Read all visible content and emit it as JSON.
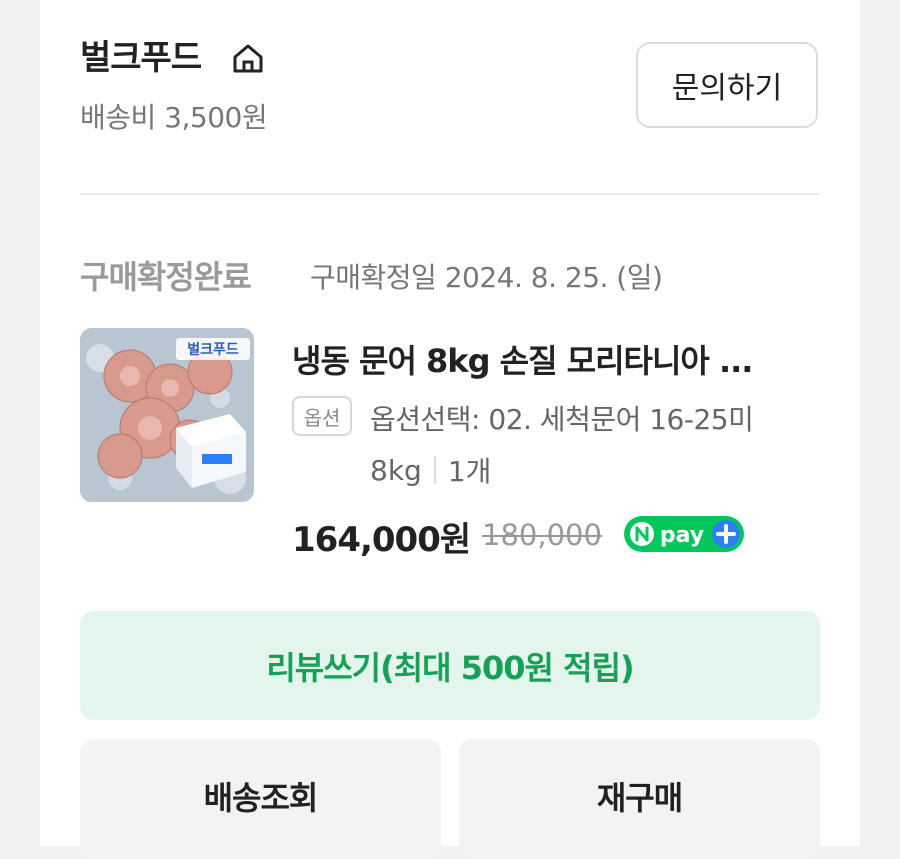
{
  "store": {
    "name": "벌크푸드",
    "shipping_fee": "배송비 3,500원",
    "inquiry_label": "문의하기"
  },
  "order": {
    "status": "구매확정완료",
    "confirm_date": "구매확정일 2024. 8. 25. (일)"
  },
  "product": {
    "title": "냉동 문어 8kg 손질 모리타니아 ...",
    "thumb_brand": "벌크푸드",
    "option_badge": "옵션",
    "option_text": "옵션선택: 02. 세척문어 16-25미",
    "option_weight": "8kg",
    "quantity": "1개",
    "price": "164,000원",
    "original_price": "180,000",
    "npay_label": "pay"
  },
  "actions": {
    "review_label": "리뷰쓰기(최대 500원 적립)",
    "track_label": "배송조회",
    "rebuy_label": "재구매"
  },
  "colors": {
    "review_bg": "#e3f5ec",
    "review_text": "#18a057",
    "npay_green": "#03c75a",
    "npay_blue": "#2d7ff9"
  }
}
